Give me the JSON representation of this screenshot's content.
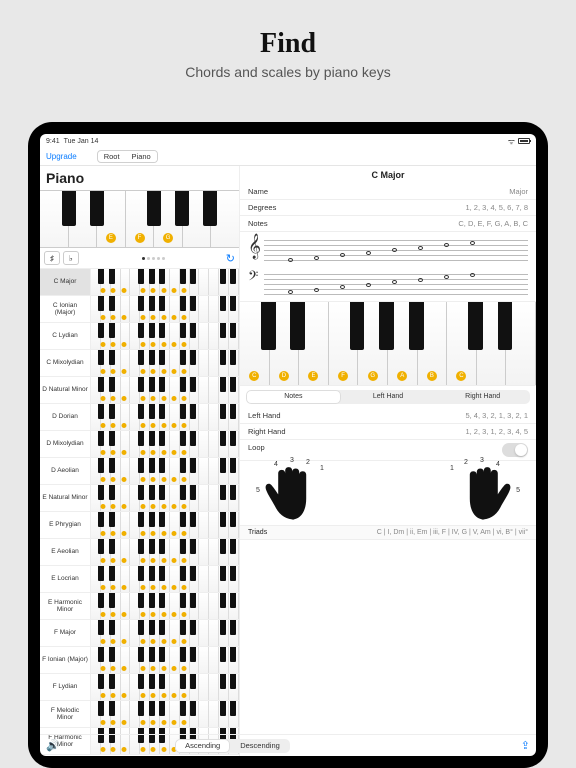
{
  "promo": {
    "title": "Find",
    "subtitle": "Chords and scales by piano keys"
  },
  "status": {
    "time": "9:41",
    "date": "Tue Jan 14"
  },
  "nav": {
    "upgrade": "Upgrade",
    "seg_root": "Root",
    "seg_piano": "Piano"
  },
  "heading": "Piano",
  "big_keys": [
    "C",
    "D",
    "E",
    "F",
    "G",
    "A",
    "B"
  ],
  "big_marked": {
    "2": "E",
    "3": "F",
    "4": "G"
  },
  "ctrl": {
    "sharp": "♯",
    "flat": "♭"
  },
  "scale_list": [
    "C Major",
    "C Ionian (Major)",
    "C Lydian",
    "C Mixolydian",
    "D Natural Minor",
    "D Dorian",
    "D Mixolydian",
    "D Aeolian",
    "E Natural Minor",
    "E Phrygian",
    "E Aeolian",
    "E Locrian",
    "E Harmonic Minor",
    "F Major",
    "F Ionian (Major)",
    "F Lydian",
    "F Melodic Minor",
    "F Harmonic Minor"
  ],
  "detail": {
    "title": "C Major",
    "name_label": "Name",
    "name_val": "Major",
    "deg_label": "Degrees",
    "deg_val": "1, 2, 3, 4, 5, 6, 7, 8",
    "notes_label": "Notes",
    "notes_val": "C, D, E, F, G, A, B, C",
    "tab_notes": "Notes",
    "tab_left": "Left Hand",
    "tab_right": "Right Hand",
    "lh_label": "Left Hand",
    "lh_val": "5, 4, 3, 2, 1, 3, 2, 1",
    "rh_label": "Right Hand",
    "rh_val": "1, 2, 3, 1, 2, 3, 4, 5",
    "loop_label": "Loop",
    "triads_label": "Triads",
    "triads_val": "C | I, Dm | ii, Em | iii, F | IV, G | V, Am | vi, B° | vii°",
    "piano_labels": [
      "C",
      "D",
      "E",
      "F",
      "G",
      "A",
      "B",
      "C"
    ]
  },
  "finger_left": [
    "5",
    "4",
    "3",
    "2",
    "1"
  ],
  "finger_right": [
    "1",
    "2",
    "3",
    "4",
    "5"
  ],
  "bottom": {
    "asc": "Ascending",
    "desc": "Descending"
  }
}
